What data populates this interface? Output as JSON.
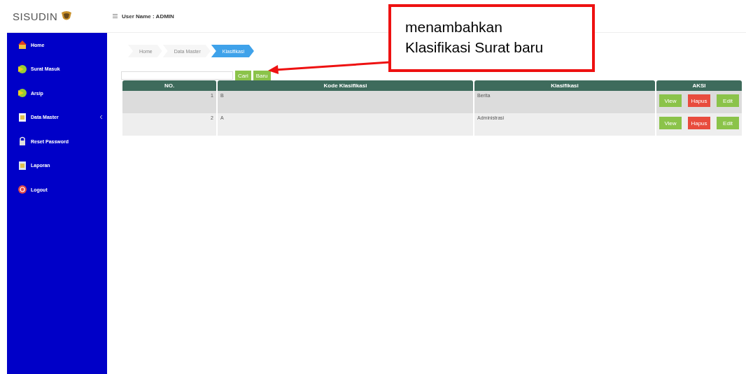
{
  "header": {
    "logo": "SISUDIN",
    "user": "User Name : ADMIN"
  },
  "sidebar": {
    "items": [
      {
        "label": "Home",
        "expandable": false
      },
      {
        "label": "Surat Masuk",
        "expandable": false
      },
      {
        "label": "Arsip",
        "expandable": false
      },
      {
        "label": "Data Master",
        "expandable": true
      },
      {
        "label": "Reset Password",
        "expandable": false
      },
      {
        "label": "Laporan",
        "expandable": false
      },
      {
        "label": "Logout",
        "expandable": false
      }
    ]
  },
  "breadcrumb": [
    {
      "label": "Home",
      "selected": false
    },
    {
      "label": "Data Master",
      "selected": false
    },
    {
      "label": "Klasifikasi",
      "selected": true
    }
  ],
  "toolbar": {
    "search_button": "Cari",
    "new_button": "Baru"
  },
  "table": {
    "columns": [
      "NO.",
      "Kode Klasifikasi",
      "Klasifikasi",
      "AKSI"
    ],
    "rows": [
      {
        "no": "1",
        "kode": "B",
        "klasifikasi": "Berita",
        "actions": [
          {
            "kind": "view",
            "label": "View"
          },
          {
            "kind": "delete",
            "label": "Hapus"
          },
          {
            "kind": "edit",
            "label": "Edit"
          }
        ]
      },
      {
        "no": "2",
        "kode": "A",
        "klasifikasi": "Administrasi",
        "actions": [
          {
            "kind": "view",
            "label": "View"
          },
          {
            "kind": "delete",
            "label": "Hapus"
          },
          {
            "kind": "edit",
            "label": "Edit"
          }
        ]
      }
    ]
  },
  "callout": {
    "lines": [
      "menambahkan",
      "Klasifikasi Surat baru"
    ]
  }
}
